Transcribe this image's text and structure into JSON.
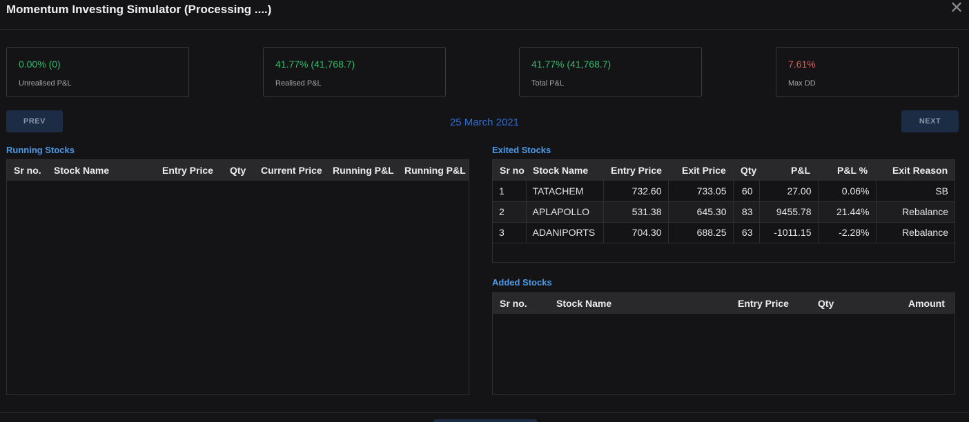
{
  "window": {
    "title": "Momentum Investing Simulator (Processing ....)",
    "close_label": "✕"
  },
  "cards": [
    {
      "value": "0.00% (0)",
      "label": "Unrealised P&L",
      "color": "#2ebd6b"
    },
    {
      "value": "41.77% (41,768.7)",
      "label": "Realised P&L",
      "color": "#2ebd6b"
    },
    {
      "value": "41.77% (41,768.7)",
      "label": "Total P&L",
      "color": "#2ebd6b"
    },
    {
      "value": "7.61%",
      "label": "Max DD",
      "color": "#e65a5a"
    }
  ],
  "nav": {
    "prev_label": "PREV",
    "next_label": "NEXT",
    "date": "25 March 2021"
  },
  "running": {
    "title": "Running Stocks",
    "headers": [
      "Sr no.",
      "Stock Name",
      "Entry Price",
      "Qty",
      "Current Price",
      "Running P&L",
      "Running P&L"
    ]
  },
  "exited": {
    "title": "Exited Stocks",
    "headers": [
      "Sr no",
      "Stock Name",
      "Entry Price",
      "Exit Price",
      "Qty",
      "P&L",
      "P&L %",
      "Exit Reason"
    ],
    "rows": [
      [
        "1",
        "TATACHEM",
        "732.60",
        "733.05",
        "60",
        "27.00",
        "0.06%",
        "SB"
      ],
      [
        "2",
        "APLAPOLLO",
        "531.38",
        "645.30",
        "83",
        "9455.78",
        "21.44%",
        "Rebalance"
      ],
      [
        "3",
        "ADANIPORTS",
        "704.30",
        "688.25",
        "63",
        "-1011.15",
        "-2.28%",
        "Rebalance"
      ]
    ]
  },
  "added": {
    "title": "Added Stocks",
    "headers": [
      "Sr no.",
      "Stock Name",
      "Entry Price",
      "Qty",
      "Amount"
    ]
  }
}
